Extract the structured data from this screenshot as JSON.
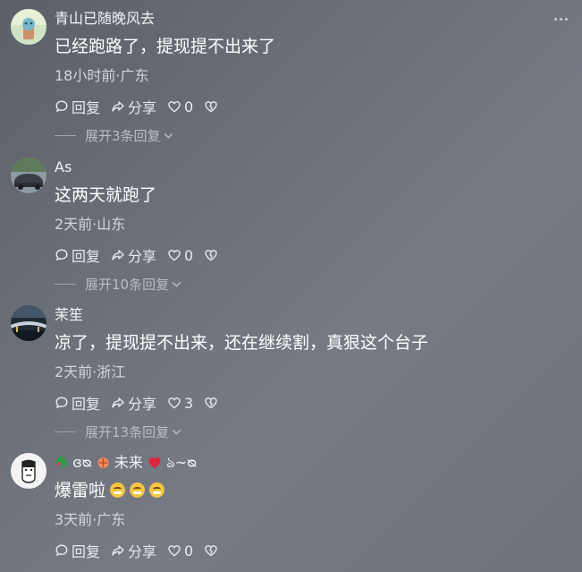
{
  "comments": [
    {
      "username": "青山已随晚风去",
      "text": "已经跑路了，提现提不出来了",
      "meta": "18小时前·广东",
      "reply_label": "回复",
      "share_label": "分享",
      "likes": "0",
      "expand_label": "展开3条回复"
    },
    {
      "username": "As",
      "text": "这两天就跑了",
      "meta": "2天前·山东",
      "reply_label": "回复",
      "share_label": "分享",
      "likes": "0",
      "expand_label": "展开10条回复"
    },
    {
      "username": "茉笙",
      "text": "凉了，提现提不出来，还在继续割，真狠这个台子",
      "meta": "2天前·浙江",
      "reply_label": "回复",
      "share_label": "分享",
      "likes": "3",
      "expand_label": "展开13条回复"
    },
    {
      "username_a": "ɞᴓ",
      "username_b": "未来",
      "username_c": "ঌ~ᴓ",
      "text": "爆雷啦",
      "meta": "3天前·广东",
      "reply_label": "回复",
      "share_label": "分享",
      "likes": "0"
    }
  ],
  "icons": {
    "reply": "speech-bubble-icon",
    "share": "share-arrow-icon",
    "like": "heart-icon",
    "dislike": "broken-heart-icon",
    "expand": "chevron-down-icon",
    "more": "more-dots-icon"
  },
  "colors": {
    "text": "#ffffff",
    "secondary": "#d3d6db",
    "muted": "#b9bcc3"
  }
}
